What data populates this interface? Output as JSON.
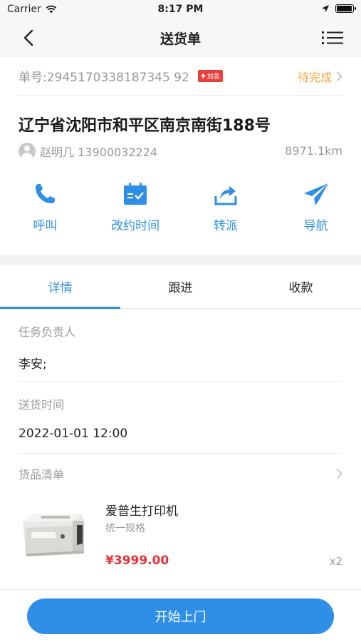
{
  "status_bar": {
    "carrier": "Carrier",
    "time": "8:17 PM",
    "battery_level": 0.95
  },
  "nav": {
    "title": "送货单"
  },
  "order": {
    "number": "单号:2945170338187345 92",
    "urgent_label": "加急",
    "status": "待完成",
    "address": "辽宁省沈阳市和平区南京南街188号",
    "contact": "赵明几 13900032224",
    "distance": "8971.1km"
  },
  "actions": [
    {
      "label": "呼叫",
      "icon": "phone-icon"
    },
    {
      "label": "改约时间",
      "icon": "calendar-icon"
    },
    {
      "label": "转派",
      "icon": "share-icon"
    },
    {
      "label": "导航",
      "icon": "navigation-icon"
    }
  ],
  "tabs": [
    {
      "label": "详情",
      "active": true
    },
    {
      "label": "跟进",
      "active": false
    },
    {
      "label": "收款",
      "active": false
    }
  ],
  "detail": {
    "owner_label": "任务负责人",
    "owner_value": "李安;",
    "time_label": "送货时间",
    "time_value": "2022-01-01 12:00",
    "goods_label": "货品清单",
    "goods": [
      {
        "name": "爱普生打印机",
        "spec": "统一规格",
        "price": "¥3999.00",
        "qty": "x2"
      }
    ]
  },
  "footer": {
    "start_label": "开始上门"
  },
  "colors": {
    "accent": "#2f8fe6",
    "warning": "#f0a73b",
    "price": "#e8313b",
    "urgent": "#e8423b"
  }
}
